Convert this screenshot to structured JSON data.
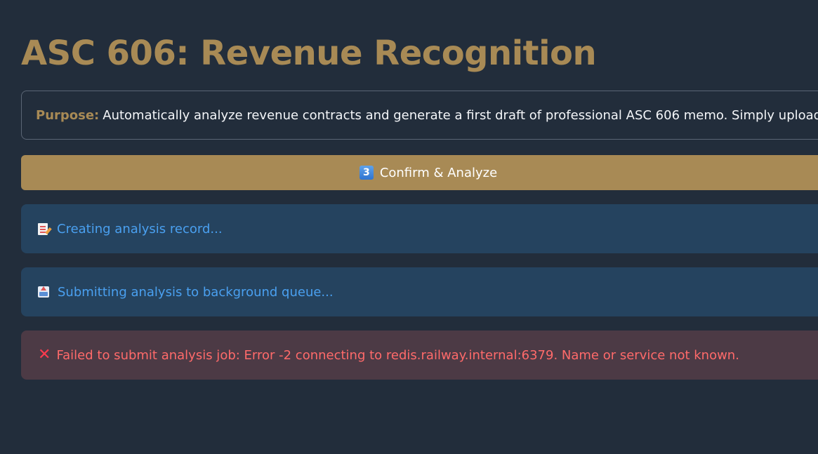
{
  "page": {
    "title": "ASC 606: Revenue Recognition"
  },
  "purpose": {
    "label": "Purpose:",
    "text": "Automatically analyze revenue contracts and generate a first draft of professional ASC 606 memo. Simply upload your docum"
  },
  "confirm_button": {
    "icon_text": "3",
    "label": "Confirm & Analyze"
  },
  "status_messages": [
    {
      "icon": "memo-icon",
      "text": "Creating analysis record..."
    },
    {
      "icon": "outbox-icon",
      "text": "Submitting analysis to background queue..."
    },
    {
      "icon": "x-icon",
      "icon_glyph": "✕",
      "text": "Failed to submit analysis job: Error -2 connecting to redis.railway.internal:6379. Name or service not known."
    }
  ],
  "colors": {
    "background": "#222d3b",
    "accent": "#a88a55",
    "info_background": "#25435f",
    "info_text": "#4aa0f0",
    "error_background": "#4c3a45",
    "error_text": "#ff6a6a"
  }
}
